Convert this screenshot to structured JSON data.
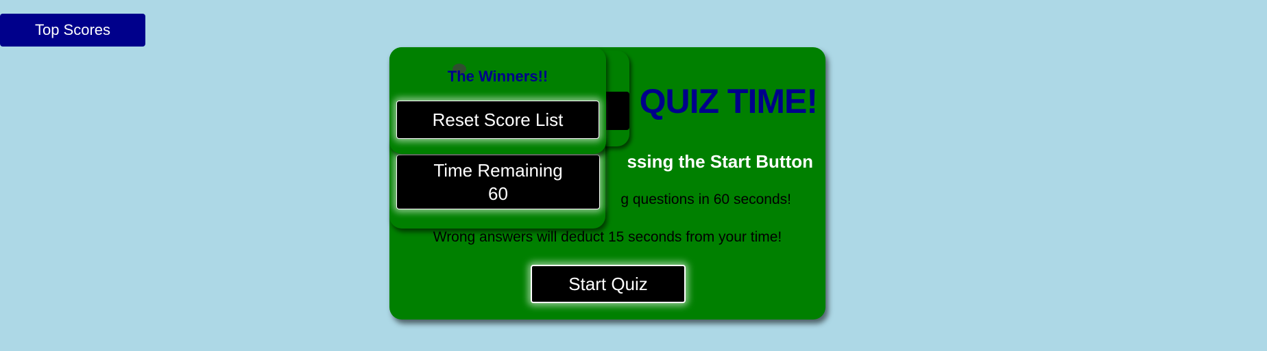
{
  "header": {
    "top_scores_label": "Top Scores"
  },
  "quiz": {
    "title": "QUIZ TIME!",
    "subtitle": "ssing the Start Button",
    "info": "g questions in 60 seconds!",
    "warning": "Wrong answers will deduct 15 seconds from your time!",
    "start_label": "Start Quiz"
  },
  "winners": {
    "title": "The Winners!!",
    "reset_label": "Reset Score List"
  },
  "timer": {
    "label": "Time Remaining",
    "value": "60"
  },
  "colors": {
    "background": "#add8e6",
    "card": "#008000",
    "accent": "#00008b",
    "button": "#000000"
  }
}
